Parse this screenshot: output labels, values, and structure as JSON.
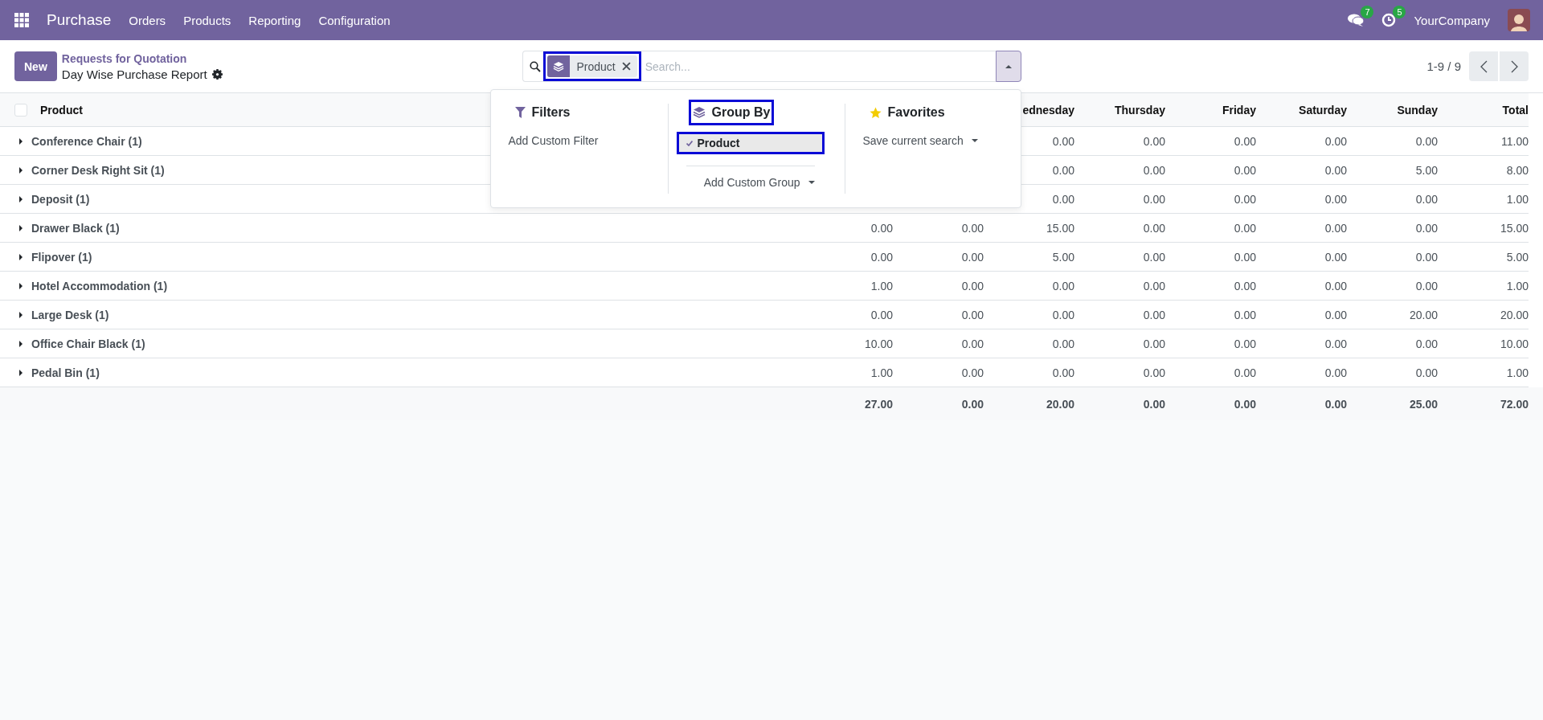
{
  "navbar": {
    "app": "Purchase",
    "menu": [
      "Orders",
      "Products",
      "Reporting",
      "Configuration"
    ],
    "messages_count": "7",
    "activities_count": "5",
    "company": "YourCompany"
  },
  "control_panel": {
    "new_button": "New",
    "breadcrumb": "Requests for Quotation",
    "title": "Day Wise Purchase Report",
    "search": {
      "facet": {
        "label": "Product",
        "highlighted": true
      },
      "placeholder": "Search...",
      "panel_open": true
    },
    "pager": "1-9 / 9"
  },
  "search_panel": {
    "filters": {
      "title": "Filters",
      "items": [
        "Add Custom Filter"
      ]
    },
    "group_by": {
      "title": "Group By",
      "highlighted": true,
      "options": [
        {
          "label": "Product",
          "selected": true,
          "highlighted": true
        }
      ],
      "custom": "Add Custom Group"
    },
    "favorites": {
      "title": "Favorites",
      "items": [
        "Save current search"
      ]
    }
  },
  "table": {
    "select_all": {
      "checked": false
    },
    "columns": [
      "Product",
      null,
      null,
      "ednesday",
      "Thursday",
      "Friday",
      "Saturday",
      "Sunday",
      "Total"
    ],
    "rows": [
      {
        "label": "Conference Chair (1)",
        "expanded": false,
        "values": [
          "0.00",
          "0.00",
          "0.00",
          "0.00",
          "0.00",
          "11.00"
        ]
      },
      {
        "label": "Corner Desk Right Sit (1)",
        "expanded": false,
        "values": [
          "0.00",
          "0.00",
          "0.00",
          "0.00",
          "5.00",
          "8.00"
        ]
      },
      {
        "label": "Deposit (1)",
        "expanded": false,
        "values": [
          "0.00",
          "0.00",
          "0.00",
          "0.00",
          "0.00",
          "1.00"
        ]
      },
      {
        "label": "Drawer Black (1)",
        "expanded": false,
        "values": [
          "0.00",
          "0.00",
          "15.00",
          "0.00",
          "0.00",
          "0.00",
          "0.00",
          "15.00"
        ]
      },
      {
        "label": "Flipover (1)",
        "expanded": false,
        "values": [
          "0.00",
          "0.00",
          "5.00",
          "0.00",
          "0.00",
          "0.00",
          "0.00",
          "5.00"
        ]
      },
      {
        "label": "Hotel Accommodation (1)",
        "expanded": false,
        "values": [
          "1.00",
          "0.00",
          "0.00",
          "0.00",
          "0.00",
          "0.00",
          "0.00",
          "1.00"
        ]
      },
      {
        "label": "Large Desk (1)",
        "expanded": false,
        "values": [
          "0.00",
          "0.00",
          "0.00",
          "0.00",
          "0.00",
          "0.00",
          "20.00",
          "20.00"
        ]
      },
      {
        "label": "Office Chair Black (1)",
        "expanded": false,
        "values": [
          "10.00",
          "0.00",
          "0.00",
          "0.00",
          "0.00",
          "0.00",
          "0.00",
          "10.00"
        ]
      },
      {
        "label": "Pedal Bin (1)",
        "expanded": false,
        "values": [
          "1.00",
          "0.00",
          "0.00",
          "0.00",
          "0.00",
          "0.00",
          "0.00",
          "1.00"
        ]
      }
    ],
    "totals": [
      "27.00",
      "0.00",
      "20.00",
      "0.00",
      "0.00",
      "0.00",
      "25.00",
      "72.00"
    ]
  }
}
